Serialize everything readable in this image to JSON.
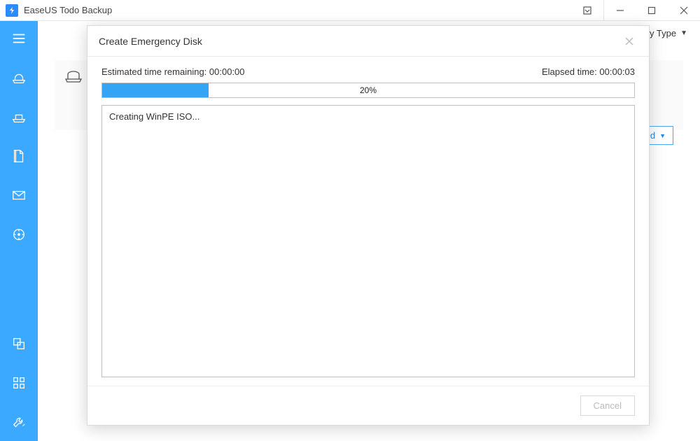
{
  "titlebar": {
    "app_title": "EaseUS Todo Backup"
  },
  "toolbar": {
    "sort_label": "Sort by Type",
    "advanced_label": "Advanced"
  },
  "sidebar": {
    "items": [
      {
        "name": "menu"
      },
      {
        "name": "disk-backup"
      },
      {
        "name": "system-backup"
      },
      {
        "name": "file-backup"
      },
      {
        "name": "mail-backup"
      },
      {
        "name": "smart-backup"
      },
      {
        "name": "clone"
      },
      {
        "name": "tools-grid"
      },
      {
        "name": "settings"
      }
    ]
  },
  "modal": {
    "title": "Create Emergency Disk",
    "est_label": "Estimated time remaining:",
    "est_value": "00:00:00",
    "elapsed_label": "Elapsed time:",
    "elapsed_value": "00:00:03",
    "progress_percent": 20,
    "progress_percent_label": "20%",
    "log_lines": [
      "Creating WinPE ISO..."
    ],
    "cancel_label": "Cancel"
  },
  "colors": {
    "accent": "#3ba9ff",
    "progress_fill": "#34a4f4",
    "link": "#1e8ae6"
  }
}
